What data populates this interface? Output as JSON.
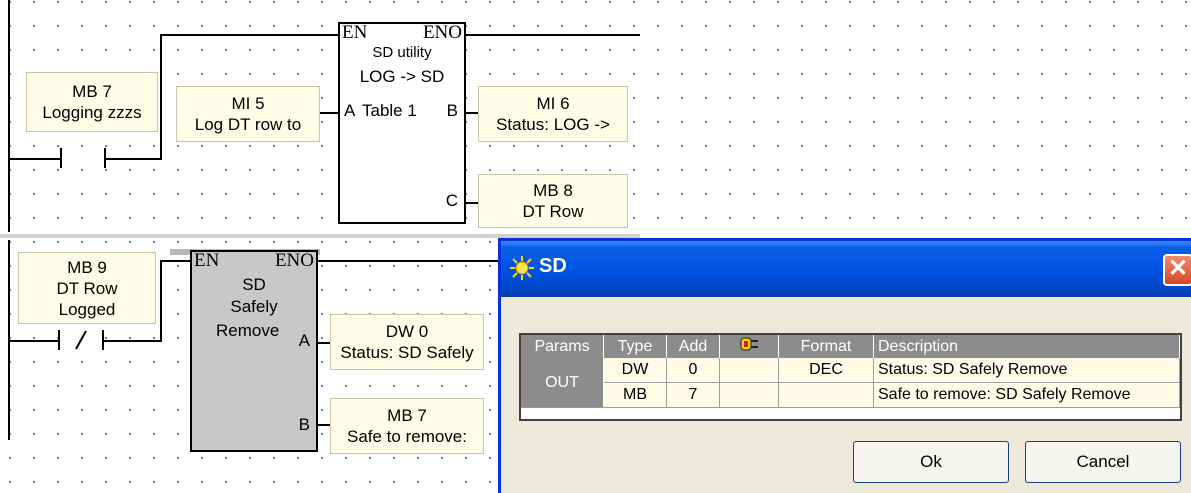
{
  "rung1": {
    "contact": {
      "address": "MB 7",
      "description": "Logging zzzs"
    },
    "block": {
      "en": "EN",
      "eno": "ENO",
      "line1": "SD utility",
      "line2": "LOG -> SD",
      "pin_a": "A",
      "pin_a_label": "Table 1",
      "pin_b": "B",
      "pin_c": "C"
    },
    "in_a": {
      "address": "MI 5",
      "description": "Log DT row to"
    },
    "out_b": {
      "address": "MI 6",
      "description": "Status: LOG ->"
    },
    "out_c": {
      "address": "MB 8",
      "description": "DT Row"
    }
  },
  "rung2": {
    "contact": {
      "address": "MB 9",
      "line2": "DT Row",
      "line3": "Logged"
    },
    "block": {
      "en": "EN",
      "eno": "ENO",
      "line1": "SD",
      "line2": "Safely",
      "line3": "Remove",
      "pin_a": "A",
      "pin_b": "B"
    },
    "out_a": {
      "address": "DW 0",
      "description": "Status: SD Safely"
    },
    "out_b": {
      "address": "MB 7",
      "description": "Safe to remove:"
    }
  },
  "dialog": {
    "title": "SD",
    "close_glyph": "✕",
    "columns": [
      "Params",
      "Type",
      "Add",
      "",
      "Format",
      "Description"
    ],
    "group": "OUT",
    "rows": [
      {
        "type": "DW",
        "add": "0",
        "flag": "",
        "format": "DEC",
        "description": "Status: SD Safely Remove"
      },
      {
        "type": "MB",
        "add": "7",
        "flag": "",
        "format": "",
        "description": "Safe to remove: SD Safely Remove"
      }
    ],
    "ok_label": "Ok",
    "cancel_label": "Cancel",
    "title_icon": "sun-icon",
    "column_icon": "plug-icon"
  },
  "colors": {
    "titlebar": "#0054e3",
    "operand_bg": "#fefbe6",
    "grid_header": "#8c8c8c",
    "disabled_block": "#c8c8c8"
  }
}
